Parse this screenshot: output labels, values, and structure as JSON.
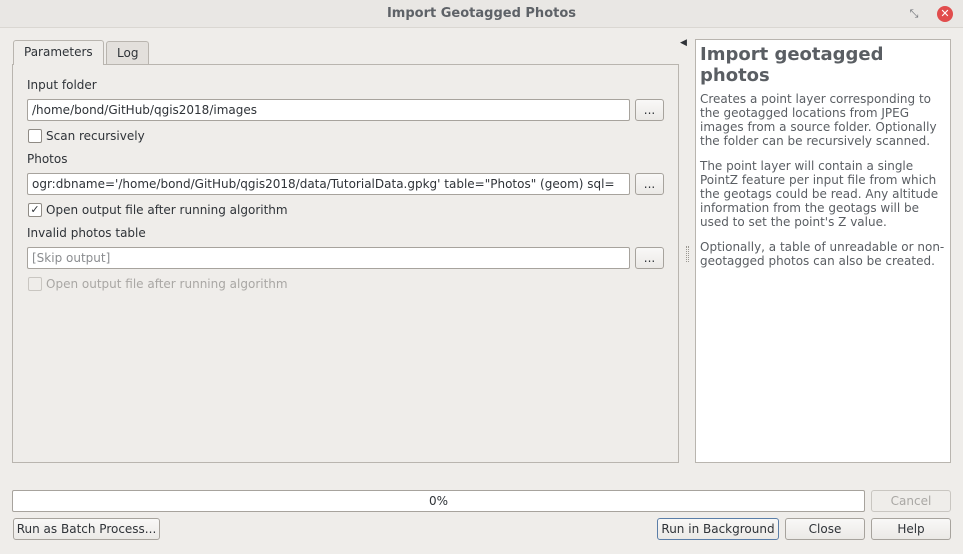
{
  "window": {
    "title": "Import Geotagged Photos",
    "restore_icon": "⤡",
    "close_icon": "✕"
  },
  "tabs": {
    "parameters": "Parameters",
    "log": "Log"
  },
  "form": {
    "input_folder_label": "Input folder",
    "input_folder_value": "/home/bond/GitHub/qgis2018/images",
    "browse_label": "...",
    "scan_recursively_label": "Scan recursively",
    "scan_recursively_checked": false,
    "photos_label": "Photos",
    "photos_value": "ogr:dbname='/home/bond/GitHub/qgis2018/data/TutorialData.gpkg' table=\"Photos\" (geom) sql=",
    "open_output_label": "Open output file after running algorithm",
    "open_output_checked": true,
    "check_mark": "✓",
    "invalid_table_label": "Invalid photos table",
    "invalid_table_placeholder": "[Skip output]",
    "open_output2_label": "Open output file after running algorithm",
    "open_output2_checked": false
  },
  "help": {
    "collapse_icon": "◀",
    "title": "Import geotagged photos",
    "paragraphs": [
      "Creates a point layer corresponding to the geotagged locations from JPEG images from a source folder. Optionally the folder can be recursively scanned.",
      "The point layer will contain a single PointZ feature per input file from which the geotags could be read. Any altitude information from the geotags will be used to set the point's Z value.",
      "Optionally, a table of unreadable or non-geotagged photos can also be created."
    ]
  },
  "progress": {
    "value": 0,
    "text": "0%"
  },
  "buttons": {
    "cancel": "Cancel",
    "batch": "Run as Batch Process...",
    "run_background": "Run in Background",
    "close": "Close",
    "help": "Help"
  }
}
